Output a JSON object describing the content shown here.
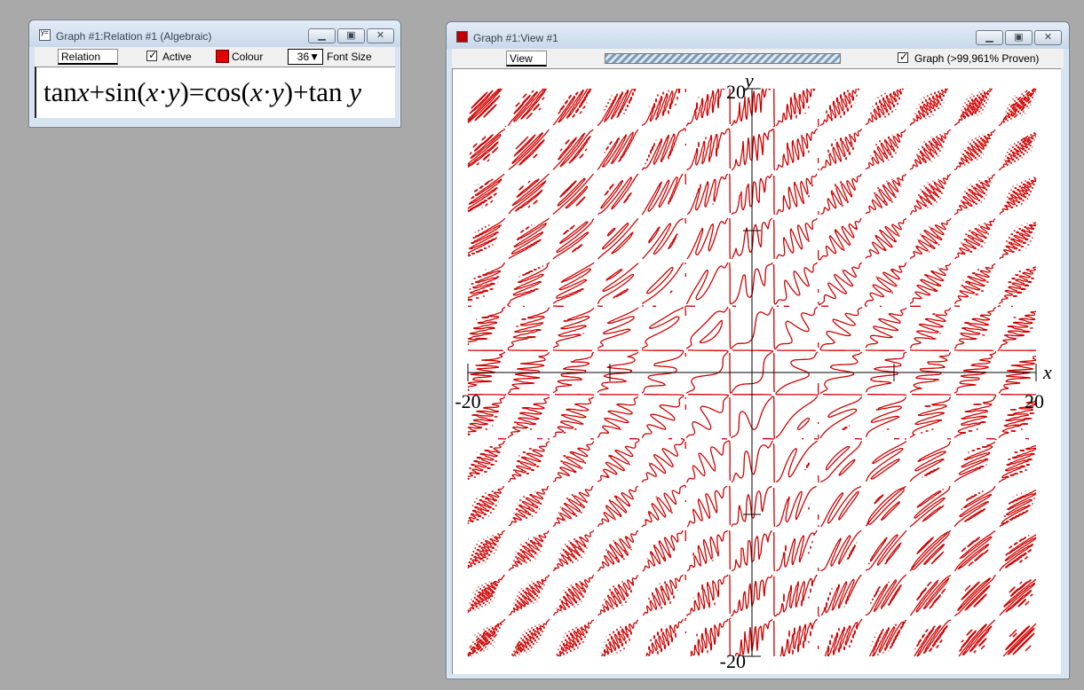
{
  "relation_window": {
    "title": "Graph #1:Relation #1 (Algebraic)",
    "tab_label": "Relation #1",
    "active_label": "Active",
    "active_checked": true,
    "colour_label": "Colour",
    "colour_value": "#e00000",
    "font_size_value": "36▼",
    "font_size_label": "Font Size",
    "equation": {
      "p1": "tan",
      "v1": "x",
      "p2": "+sin(",
      "v2": "x",
      "p3": "·",
      "v3": "y",
      "p4": ")=cos(",
      "v4": "x",
      "p5": "·",
      "v5": "y",
      "p6": ")+tan ",
      "v6": "y"
    }
  },
  "view_window": {
    "title": "Graph #1:View #1",
    "tab_label": "View #1",
    "graph_label": "Graph (>99,961% Proven)",
    "graph_checked": true
  },
  "chart_data": {
    "type": "scatter",
    "title": "",
    "relation": "tan x + sin(x·y) = cos(x·y) + tan y",
    "curve_color": "#d00000",
    "xlabel": "x",
    "ylabel": "y",
    "xlim": [
      -20,
      20
    ],
    "ylim": [
      -20,
      20
    ],
    "tick_labels": {
      "x_min": "-20",
      "x_max": "20",
      "y_min": "-20",
      "y_max": "20"
    },
    "grid": false
  },
  "icons": {
    "relation_window_icon": "relation-icon",
    "view_window_icon": "view-icon",
    "minimize": "minimize-icon",
    "maximize": "maximize-icon",
    "close": "close-icon"
  }
}
